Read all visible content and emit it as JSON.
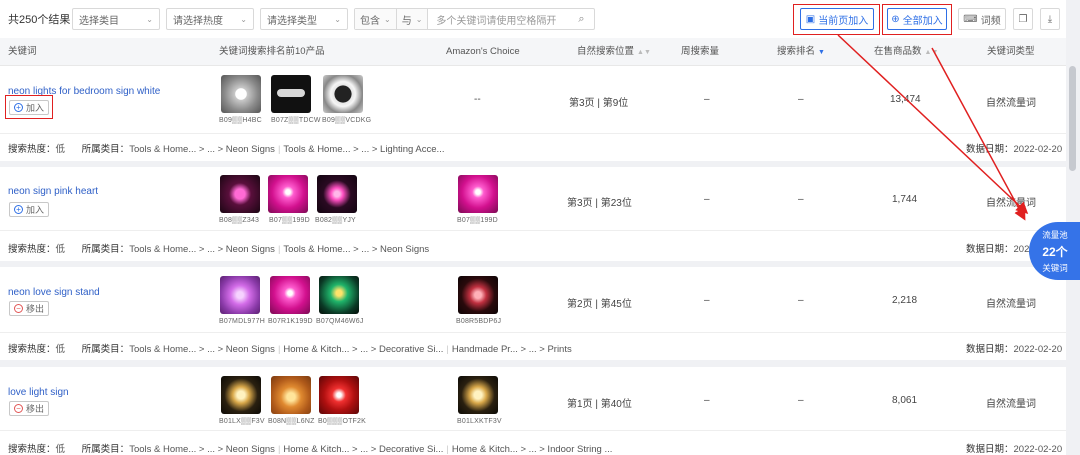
{
  "toolbar": {
    "total": "共250个结果",
    "category_placeholder": "选择类目",
    "heat_placeholder": "请选择热度",
    "type_placeholder": "请选择类型",
    "match_mode": "包含",
    "logic": "与",
    "keyword_placeholder": "多个关键词请使用空格隔开",
    "add_page_label": "当前页加入",
    "add_all_label": "全部加入",
    "phrase_label": "词频"
  },
  "columns": {
    "keyword": "关键词",
    "top_products": "关键词搜索排名前10产品",
    "amazon_choice": "Amazon's Choice",
    "organic_rank": "自然搜索位置",
    "weekly_search": "周搜索量",
    "search_rank": "搜索排名",
    "products_count": "在售商品数",
    "keyword_type": "关键词类型"
  },
  "labels": {
    "heat": "搜索热度：",
    "category": "所属类目：",
    "date": "数据日期：",
    "add": "加入",
    "remove": "移出"
  },
  "rows": [
    {
      "keyword": "neon lights for bedroom sign white",
      "action": "加入",
      "products": [
        "B09▒▒H4BC",
        "B07Z▒▒TDCW",
        "B09▒▒VCDKG"
      ],
      "amazon_choice": "--",
      "amazon_choice_asin": "",
      "organic_rank": "第3页 | 第9位",
      "weekly_search": "–",
      "search_rank": "–",
      "products_count": "13,474",
      "keyword_type": "自然流量词",
      "heat": "低",
      "categories": [
        "Tools & Home... > ... > Neon Signs",
        "Tools & Home... > ... > Lighting Acce..."
      ],
      "date": "2022-02-20"
    },
    {
      "keyword": "neon sign pink heart",
      "action": "加入",
      "products": [
        "B08▒▒Z343",
        "B07▒▒199D",
        "B082▒▒YJY"
      ],
      "amazon_choice": "",
      "amazon_choice_asin": "B07▒▒199D",
      "organic_rank": "第3页 | 第23位",
      "weekly_search": "–",
      "search_rank": "–",
      "products_count": "1,744",
      "keyword_type": "自然流量词",
      "heat": "低",
      "categories": [
        "Tools & Home... > ... > Neon Signs",
        "Tools & Home... > ... > Neon Signs"
      ],
      "date": "2022-02-20"
    },
    {
      "keyword": "neon love sign stand",
      "action": "移出",
      "products": [
        "B07MDL977H",
        "B07R1K199D",
        "B07QM46W6J"
      ],
      "amazon_choice": "",
      "amazon_choice_asin": "B08R5BDP6J",
      "organic_rank": "第2页 | 第45位",
      "weekly_search": "–",
      "search_rank": "–",
      "products_count": "2,218",
      "keyword_type": "自然流量词",
      "heat": "低",
      "categories": [
        "Tools & Home... > ... > Neon Signs",
        "Home & Kitch... > ... > Decorative Si...",
        "Handmade Pr... > ... > Prints"
      ],
      "date": "2022-02-20"
    },
    {
      "keyword": "love light sign",
      "action": "移出",
      "products": [
        "B01LX▒▒F3V",
        "B08N▒▒L6NZ",
        "B0▒▒▒OTF2K"
      ],
      "amazon_choice": "",
      "amazon_choice_asin": "B01LXKTF3V",
      "organic_rank": "第1页 | 第40位",
      "weekly_search": "–",
      "search_rank": "–",
      "products_count": "8,061",
      "keyword_type": "自然流量词",
      "heat": "低",
      "categories": [
        "Tools & Home... > ... > Neon Signs",
        "Home & Kitch... > ... > Decorative Si...",
        "Home & Kitch... > ... > Indoor String ..."
      ],
      "date": "2022-02-20"
    }
  ],
  "float_badge": {
    "line1": "流量池",
    "count": "22个",
    "line3": "关键词"
  },
  "colors": {
    "accent": "#2e6fe6",
    "annotation_red": "#e02020",
    "badge_blue": "#3573e8"
  }
}
